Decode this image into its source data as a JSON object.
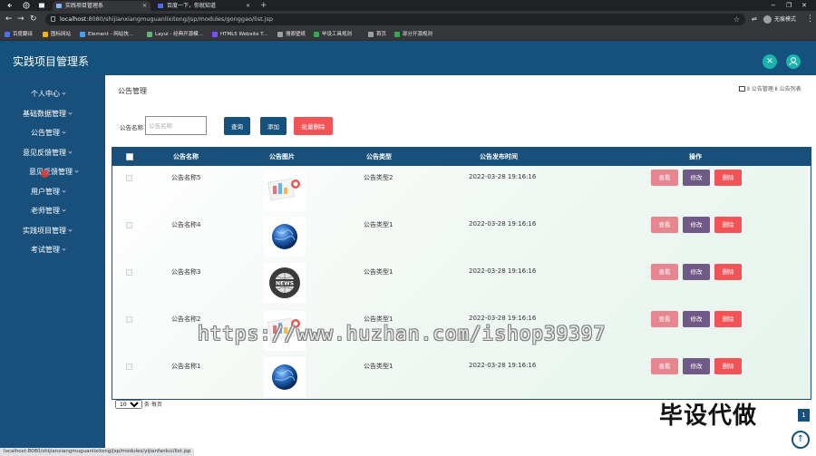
{
  "browser": {
    "tabs": [
      {
        "title": "实践项目管理系",
        "active": true
      },
      {
        "title": "百度一下，你就知道",
        "active": false
      }
    ],
    "url_host": "localhost",
    "url_rest": ":8080/shijianxiangmuguanlixitong/jsp/modules/gonggao/list.jsp",
    "profile_label": "无痕模式",
    "bookmarks": [
      "百度翻译",
      "图标网站",
      "Element - 网站快...",
      "Layui - 经典开源模...",
      "HTML5 Website T...",
      "搜索壁纸",
      "毕设工具规则",
      "首页",
      "部分开源规则"
    ],
    "status_url": "localhost:8080/shijianxiangmuguanlixitong/jsp/modules/yijianfankui/list.jsp"
  },
  "app": {
    "title": "实践项目管理系",
    "header_icons": [
      "tools-icon",
      "user-icon"
    ]
  },
  "sidebar": {
    "items": [
      {
        "label": "个人中心"
      },
      {
        "label": "基础数据管理"
      },
      {
        "label": "公告管理"
      },
      {
        "label": "意见反馈管理"
      },
      {
        "label": "意见反馈管理"
      },
      {
        "label": "用户管理"
      },
      {
        "label": "老师管理"
      },
      {
        "label": "实践项目管理"
      },
      {
        "label": "考试管理"
      }
    ]
  },
  "page": {
    "title": "公告管理",
    "breadcrumb": "Ⅱ 公告管理 Ⅱ 公告列表"
  },
  "search": {
    "label": "公告名称",
    "placeholder": "公告名称",
    "query_button": "查询",
    "add_button": "添加",
    "batch_delete_button": "批量删除"
  },
  "table": {
    "headers": [
      "公告名称",
      "公告图片",
      "公告类型",
      "公告发布时间",
      "操作"
    ],
    "action_labels": {
      "view": "查看",
      "edit": "修改",
      "delete": "删除"
    },
    "rows": [
      {
        "name": "公告名称5",
        "type": "公告类型2",
        "time": "2022-03-28 19:16:16",
        "image": "chart-document-image"
      },
      {
        "name": "公告名称4",
        "type": "公告类型1",
        "time": "2022-03-28 19:16:16",
        "image": "globe-image"
      },
      {
        "name": "公告名称3",
        "type": "公告类型1",
        "time": "2022-03-28 19:16:16",
        "image": "news-globe-image"
      },
      {
        "name": "公告名称2",
        "type": "公告类型1",
        "time": "2022-03-28 19:16:16",
        "image": "chart-document-image"
      },
      {
        "name": "公告名称1",
        "type": "公告类型1",
        "time": "2022-03-28 19:16:16",
        "image": "globe-image"
      }
    ]
  },
  "pagination": {
    "page_size": "10",
    "page_size_suffix": "条 每页",
    "current_page": "1"
  },
  "overlays": {
    "watermark": "https://www.huzhan.com/ishop39397",
    "banner": "毕设代做"
  },
  "colors": {
    "primary": "#14517c",
    "accent_teal": "#1ab3ad",
    "btn_query": "#14517c",
    "btn_add": "#14517c",
    "btn_batch_delete": "#f25357",
    "view": "#e8868f",
    "edit": "#6f5a87",
    "delete": "#f25357"
  }
}
